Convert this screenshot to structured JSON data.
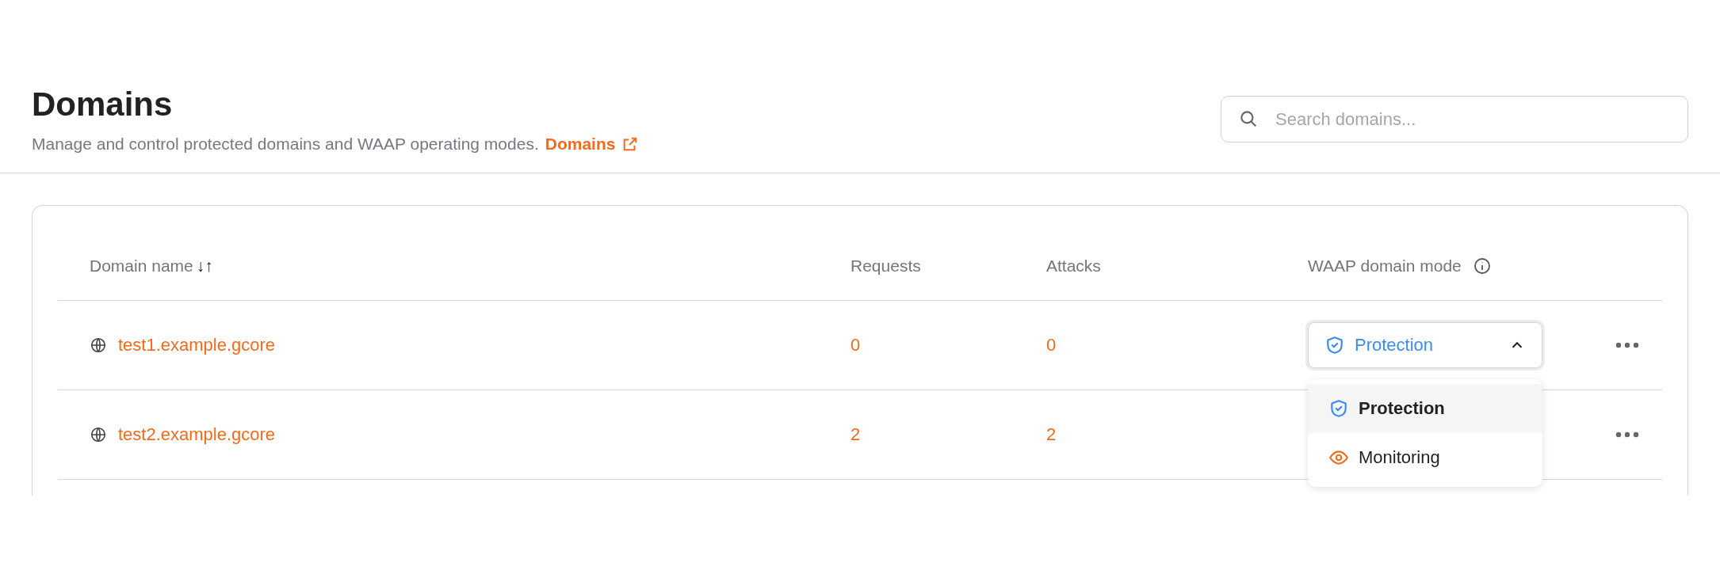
{
  "header": {
    "title": "Domains",
    "description": "Manage and control protected domains and WAAP operating modes.",
    "doc_link": "Domains"
  },
  "search": {
    "placeholder": "Search domains..."
  },
  "table": {
    "columns": [
      {
        "label": "Domain name",
        "sort": "↓↑"
      },
      {
        "label": "Requests"
      },
      {
        "label": "Attacks"
      },
      {
        "label": "WAAP domain mode",
        "info": true
      }
    ],
    "rows": [
      {
        "name": "test1.example.gcore",
        "requests": "0",
        "attacks": "0",
        "mode": {
          "value": "Protection",
          "kind": "protection",
          "expanded": true,
          "options": [
            {
              "label": "Protection",
              "kind": "protection",
              "selected": true
            },
            {
              "label": "Monitoring",
              "kind": "monitoring",
              "selected": false
            }
          ]
        }
      },
      {
        "name": "test2.example.gcore",
        "requests": "2",
        "attacks": "2"
      }
    ]
  }
}
